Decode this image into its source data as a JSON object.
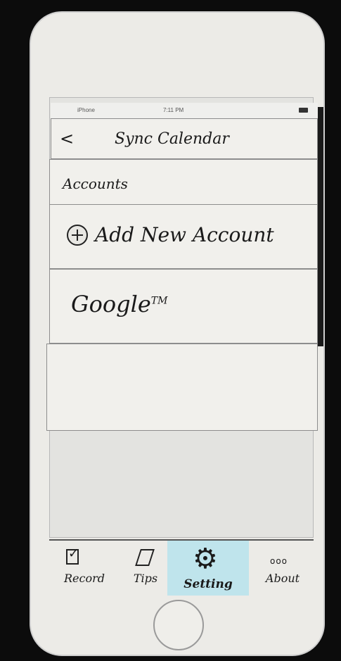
{
  "status_bar": {
    "carrier": "iPhone",
    "time": "7:11 PM"
  },
  "nav": {
    "back_glyph": "<",
    "title": "Sync Calendar"
  },
  "accounts": {
    "section_label": "Accounts",
    "add_new_label": "Add New Account",
    "items": [
      {
        "name": "Google",
        "mark": "TM"
      }
    ]
  },
  "tabbar": {
    "tabs": [
      {
        "label": "Record",
        "icon": "checkbox-icon"
      },
      {
        "label": "Tips",
        "icon": "note-icon"
      },
      {
        "label": "Setting",
        "icon": "gear-icon",
        "selected": true
      },
      {
        "label": "About",
        "icon": "ellipsis-icon"
      }
    ],
    "selected_color": "#bfe4ec"
  }
}
